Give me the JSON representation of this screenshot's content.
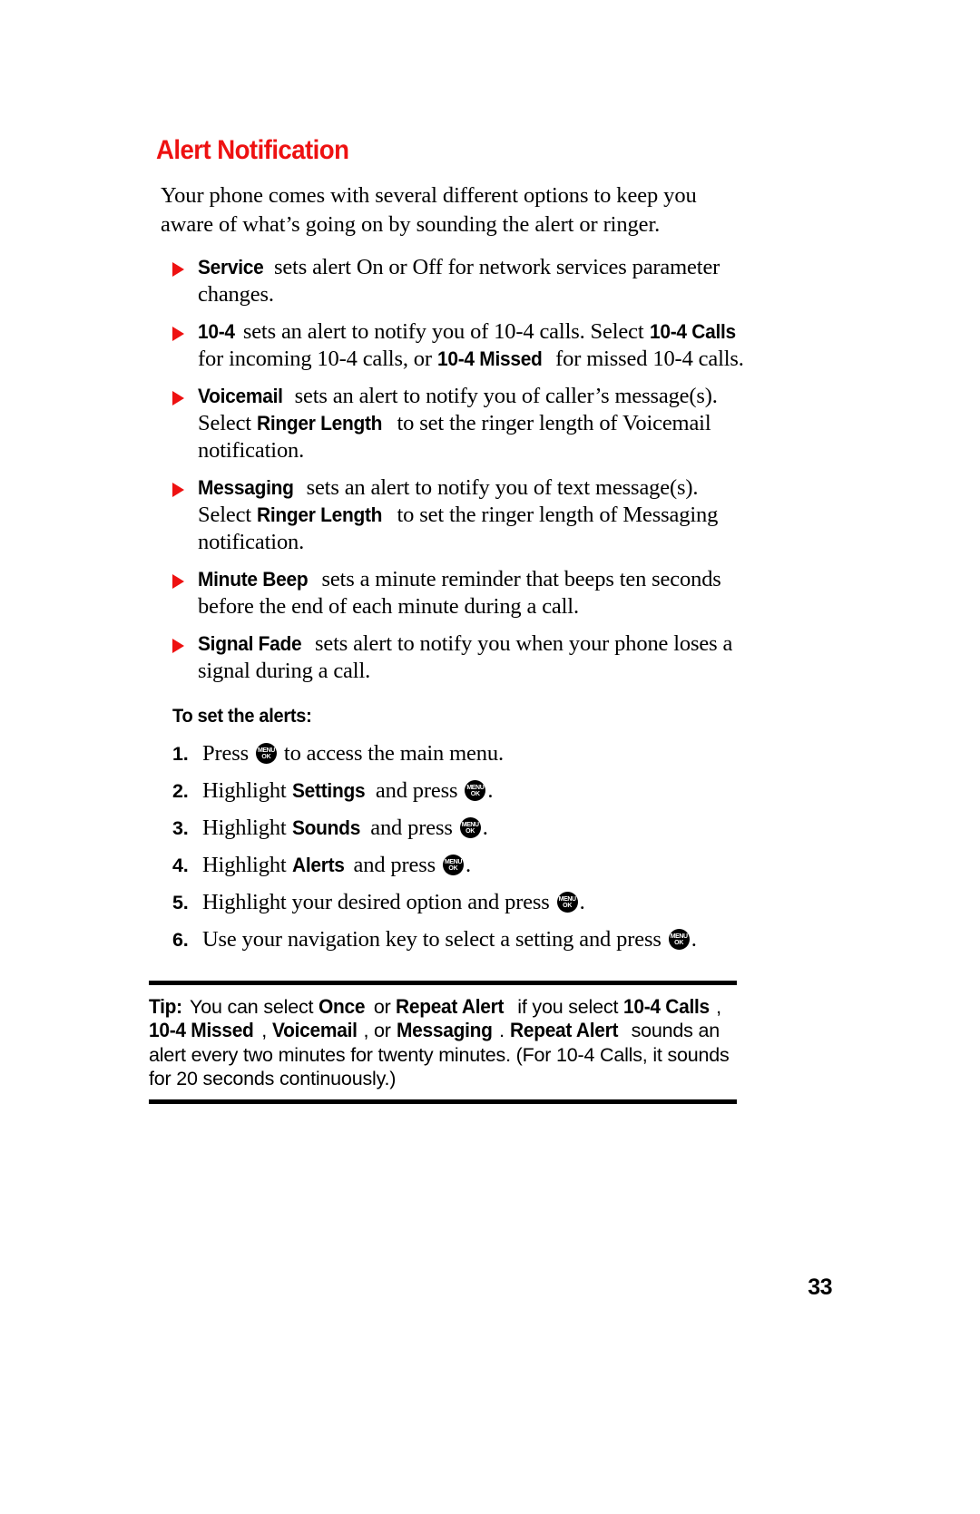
{
  "page": {
    "number": "33",
    "section_title": "Alert Notification",
    "intro": "Your phone comes with several different options to keep you aware of what’s going on by sounding the alert or ringer."
  },
  "bullets": [
    {
      "term": "Service",
      "parts": [
        {
          "text": "Service",
          "bold": true
        },
        {
          "text": " sets alert On or Off for network services parameter changes.",
          "bold": false
        }
      ]
    },
    {
      "term": "10-4",
      "parts": [
        {
          "text": "10-4",
          "bold": true
        },
        {
          "text": " sets an alert to notify you of 10-4 calls. Select ",
          "bold": false
        },
        {
          "text": "10-4 Calls",
          "bold": true
        },
        {
          "text": " for incoming 10-4 calls, or ",
          "bold": false
        },
        {
          "text": "10-4 Missed",
          "bold": true
        },
        {
          "text": " for missed 10-4 calls.",
          "bold": false
        }
      ]
    },
    {
      "term": "Voicemail",
      "parts": [
        {
          "text": "Voicemail",
          "bold": true
        },
        {
          "text": " sets an alert to notify you of caller’s message(s). Select ",
          "bold": false
        },
        {
          "text": "Ringer Length",
          "bold": true
        },
        {
          "text": " to set the ringer length of Voicemail notification.",
          "bold": false
        }
      ]
    },
    {
      "term": "Messaging",
      "parts": [
        {
          "text": "Messaging",
          "bold": true
        },
        {
          "text": " sets an alert to notify you of text message(s). Select ",
          "bold": false
        },
        {
          "text": "Ringer Length",
          "bold": true
        },
        {
          "text": " to set the ringer length of Messaging notification.",
          "bold": false
        }
      ]
    },
    {
      "term": "Minute Beep",
      "parts": [
        {
          "text": "Minute Beep",
          "bold": true
        },
        {
          "text": " sets a minute reminder that beeps ten seconds before the end of each minute during a call.",
          "bold": false
        }
      ]
    },
    {
      "term": "Signal Fade",
      "parts": [
        {
          "text": "Signal Fade",
          "bold": true
        },
        {
          "text": " sets alert to notify you when your phone loses a signal during a call.",
          "bold": false
        }
      ]
    }
  ],
  "procedure": {
    "heading": "To set the alerts:",
    "steps": [
      {
        "number": "1.",
        "parts": [
          {
            "text": "Press ",
            "bold": false
          },
          {
            "key": "menu-ok"
          },
          {
            "text": " to access the main menu.",
            "bold": false
          }
        ]
      },
      {
        "number": "2.",
        "parts": [
          {
            "text": "Highlight ",
            "bold": false
          },
          {
            "text": "Settings",
            "bold": true
          },
          {
            "text": " and press ",
            "bold": false
          },
          {
            "key": "menu-ok"
          },
          {
            "text": ".",
            "bold": false
          }
        ]
      },
      {
        "number": "3.",
        "parts": [
          {
            "text": "Highlight ",
            "bold": false
          },
          {
            "text": "Sounds",
            "bold": true
          },
          {
            "text": " and press ",
            "bold": false
          },
          {
            "key": "menu-ok"
          },
          {
            "text": ".",
            "bold": false
          }
        ]
      },
      {
        "number": "4.",
        "parts": [
          {
            "text": "Highlight ",
            "bold": false
          },
          {
            "text": "Alerts",
            "bold": true
          },
          {
            "text": " and press ",
            "bold": false
          },
          {
            "key": "menu-ok"
          },
          {
            "text": ".",
            "bold": false
          }
        ]
      },
      {
        "number": "5.",
        "parts": [
          {
            "text": "Highlight your desired option and press ",
            "bold": false
          },
          {
            "key": "menu-ok"
          },
          {
            "text": ".",
            "bold": false
          }
        ]
      },
      {
        "number": "6.",
        "parts": [
          {
            "text": "Use your navigation key to select a setting and press ",
            "bold": false
          },
          {
            "key": "menu-ok"
          },
          {
            "text": ".",
            "bold": false
          }
        ]
      }
    ]
  },
  "tip": {
    "label": "Tip:",
    "parts": [
      {
        "text": "Tip:",
        "bold": true
      },
      {
        "text": " You can select ",
        "bold": false
      },
      {
        "text": "Once",
        "bold": true
      },
      {
        "text": " or ",
        "bold": false
      },
      {
        "text": "Repeat Alert",
        "bold": true
      },
      {
        "text": " if you select ",
        "bold": false
      },
      {
        "text": "10-4 Calls",
        "bold": true
      },
      {
        "text": ", ",
        "bold": false
      },
      {
        "text": "10-4 Missed",
        "bold": true
      },
      {
        "text": ", ",
        "bold": false
      },
      {
        "text": "Voicemail",
        "bold": true
      },
      {
        "text": ", or ",
        "bold": false
      },
      {
        "text": "Messaging",
        "bold": true
      },
      {
        "text": ". ",
        "bold": false
      },
      {
        "text": "Repeat Alert",
        "bold": true
      },
      {
        "text": " sounds an alert every two minutes for twenty minutes. (For 10-4 Calls, it sounds for 20 seconds continuously.)",
        "bold": false
      }
    ]
  },
  "icons": {
    "menu_ok": {
      "line1": "MENU",
      "line2": "OK"
    },
    "bullet": "triangle-right"
  },
  "colors": {
    "heading": "#ee1111",
    "bullet": "#ee1111",
    "text": "#000000",
    "background": "#ffffff"
  }
}
